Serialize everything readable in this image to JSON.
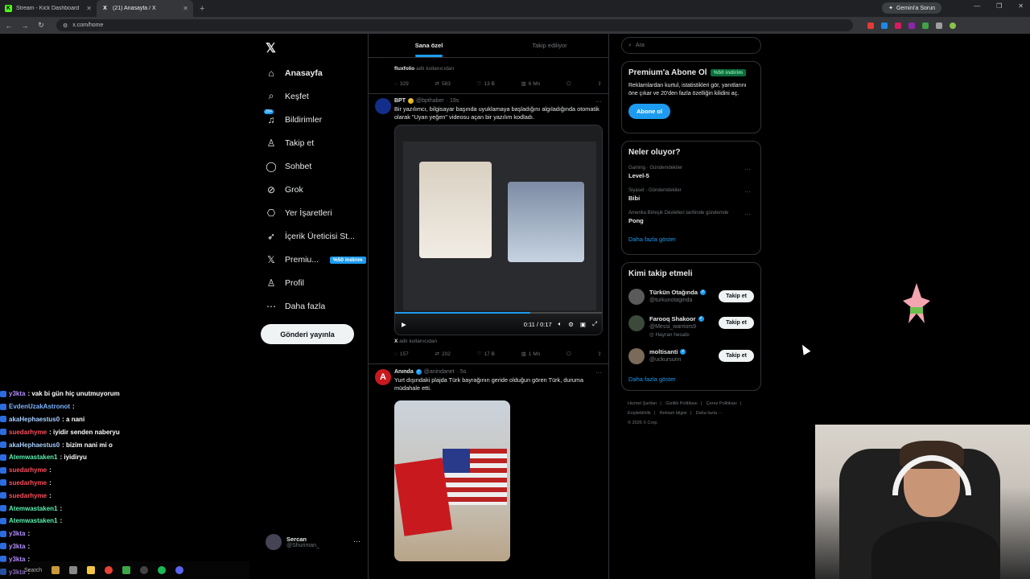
{
  "browser": {
    "tabs": [
      {
        "title": "Stream - Kick Dashboard",
        "icon": "K"
      },
      {
        "title": "(21) Anasayfa / X",
        "icon": "X"
      }
    ],
    "url": "x.com/home",
    "gemini_label": "Gemini'a Sorun"
  },
  "sidebar": {
    "logo": "𝕏",
    "items": [
      {
        "label": "Anasayfa",
        "icon": "home-icon",
        "glyph": "⌂"
      },
      {
        "label": "Keşfet",
        "icon": "search-icon",
        "glyph": "⌕"
      },
      {
        "label": "Bildirimler",
        "icon": "bell-icon",
        "glyph": "♫",
        "badge": "20+"
      },
      {
        "label": "Takip et",
        "icon": "person-add-icon",
        "glyph": "♙"
      },
      {
        "label": "Sohbet",
        "icon": "chat-icon",
        "glyph": "◯"
      },
      {
        "label": "Grok",
        "icon": "grok-icon",
        "glyph": "⊘"
      },
      {
        "label": "Yer İşaretleri",
        "icon": "bookmark-icon",
        "glyph": "⎔"
      },
      {
        "label": "İçerik Üreticisi St...",
        "icon": "rocket-icon",
        "glyph": "➶"
      },
      {
        "label": "Premiu...",
        "icon": "x-premium-icon",
        "glyph": "𝕏",
        "pill": "%50 indirim"
      },
      {
        "label": "Profil",
        "icon": "profile-icon",
        "glyph": "♙"
      },
      {
        "label": "Daha fazla",
        "icon": "more-circle-icon",
        "glyph": "⋯"
      }
    ],
    "post_button": "Gönderi yayınla",
    "account": {
      "name": "Sercan",
      "handle": "@Shuriman_"
    }
  },
  "feed": {
    "tabs": [
      "Sana özel",
      "Takip ediliyor"
    ],
    "top_tweet": {
      "source_user": "fluxfolio",
      "source_suffix": "adlı kullanıcıdan",
      "replies": "329",
      "reposts": "583",
      "likes": "13 B",
      "views": "6 Mn"
    },
    "tweet1": {
      "name": "BPT",
      "handle": "@bpthaber",
      "time": "· 19s",
      "text": "Bir yazılımcı, bilgisayar başında uyuklamaya başladığını algıladığında otomatik olarak \"Uyan yeğen\" videosu açan bir yazılım kodladı.",
      "video_time": "0:11 / 0:17",
      "video_progress": 0.65,
      "source_user": "X",
      "source_suffix": "adlı kullanıcıdan",
      "replies": "157",
      "reposts": "202",
      "likes": "17 B",
      "views": "1 Mn"
    },
    "tweet2": {
      "name": "Anında",
      "handle": "@anindanet",
      "time": "· 5s",
      "text": "Yurt dışındaki plajda Türk bayrağının geride olduğun gören Türk, duruma müdahale etti."
    }
  },
  "right": {
    "search_placeholder": "Ara",
    "premium": {
      "title": "Premium'a Abone Ol",
      "pill": "%50 indirim",
      "desc": "Reklamlardan kurtul, istatistikleri gör, yanıtlarını öne çıkar ve 20'den fazla özelliğin kilidini aç.",
      "button": "Abone ol"
    },
    "trends": {
      "title": "Neler oluyor?",
      "items": [
        {
          "context": "Gaming · Gündemdekiler",
          "topic": "Level-5"
        },
        {
          "context": "Siyaset · Gündemdekiler",
          "topic": "Bibi"
        },
        {
          "context": "Amerika Birleşik Devletleri tarihinde gündemde",
          "topic": "Pong"
        }
      ],
      "show_more": "Daha fazla göster"
    },
    "who_to_follow": {
      "title": "Kimi takip etmeli",
      "users": [
        {
          "name": "Türkün Otağında",
          "handle": "@turkunotaginda",
          "extra": "",
          "button": "Takip et"
        },
        {
          "name": "Farooq Shakoor",
          "handle": "@Messi_warriors9",
          "extra": "Hayran hesabı",
          "button": "Takip et"
        },
        {
          "name": "moltisanti",
          "handle": "@uckursunn",
          "extra": "",
          "button": "Takip et"
        }
      ],
      "show_more": "Daha fazla göster"
    },
    "footer": [
      "Hizmet Şartları",
      "|",
      "Gizlilik Politikası",
      "|",
      "Çerez Politikası",
      "|",
      "Erişilebilirlik",
      "|",
      "Reklam bilgisi",
      "|",
      "Daha fazla ···",
      "© 2025 X Corp."
    ]
  },
  "chat": [
    {
      "user": "y3kta",
      "msg": ": vak bi gün hiç unutmuyorum",
      "color": "#b48cff"
    },
    {
      "user": "EvdenUzakAstronot",
      "msg": ":",
      "color": "#7fb4ff"
    },
    {
      "user": "akaHephaestus0",
      "msg": ": a nani",
      "color": "#a8d0ff"
    },
    {
      "user": "suedarhyme",
      "msg": ": iyidir senden naberyu",
      "color": "#ff4d5e"
    },
    {
      "user": "akaHephaestus0",
      "msg": ": bizim nani mi o",
      "color": "#a8d0ff"
    },
    {
      "user": "Atemwastaken1",
      "msg": ": iyidiryu",
      "color": "#5cf0b0"
    },
    {
      "user": "suedarhyme",
      "msg": ":",
      "color": "#ff4d5e"
    },
    {
      "user": "suedarhyme",
      "msg": ":",
      "color": "#ff4d5e"
    },
    {
      "user": "suedarhyme",
      "msg": ":",
      "color": "#ff4d5e"
    },
    {
      "user": "Atemwastaken1",
      "msg": ":",
      "color": "#5cf0b0"
    },
    {
      "user": "Atemwastaken1",
      "msg": ":",
      "color": "#5cf0b0"
    },
    {
      "user": "y3kta",
      "msg": ":",
      "color": "#b48cff"
    },
    {
      "user": "y3kta",
      "msg": ":",
      "color": "#b48cff"
    },
    {
      "user": "y3kta",
      "msg": ":",
      "color": "#b48cff"
    },
    {
      "user": "y3kta",
      "msg": ":",
      "color": "#b48cff"
    }
  ],
  "taskbar": {
    "search": "Search"
  }
}
